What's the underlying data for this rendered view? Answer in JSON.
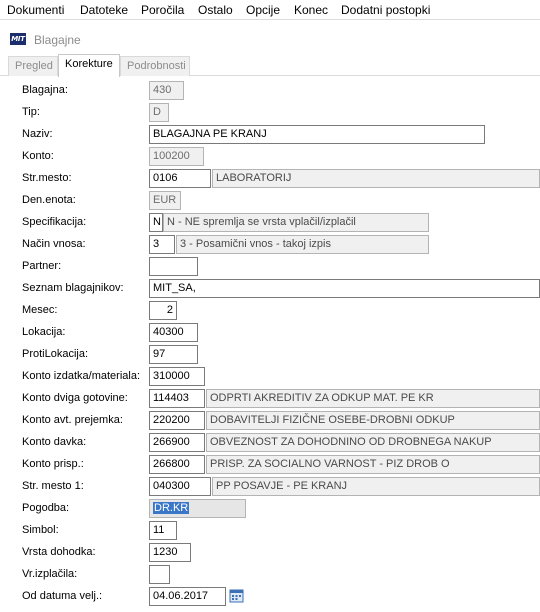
{
  "menu": [
    "Dokumenti",
    "Datoteke",
    "Poročila",
    "Ostalo",
    "Opcije",
    "Konec",
    "Dodatni postopki"
  ],
  "window": {
    "logo": "MIT",
    "title": "Blagajne"
  },
  "tabs": [
    "Pregled",
    "Korekture",
    "Podrobnosti"
  ],
  "form": {
    "blagajna": {
      "label": "Blagajna:",
      "value": "430"
    },
    "tip": {
      "label": "Tip:",
      "value": "D"
    },
    "naziv": {
      "label": "Naziv:",
      "value": "BLAGAJNA PE KRANJ"
    },
    "konto": {
      "label": "Konto:",
      "value": "100200"
    },
    "strmesto": {
      "label": "Str.mesto:",
      "value": "0106",
      "desc": "LABORATORIJ"
    },
    "denenota": {
      "label": "Den.enota:",
      "value": "EUR"
    },
    "specifikacija": {
      "label": "Specifikacija:",
      "value": "N",
      "desc": "N - NE spremlja se vrsta vplačil/izplačil"
    },
    "nacin": {
      "label": "Način vnosa:",
      "value": "3",
      "desc": "3 - Posamični vnos - takoj izpis"
    },
    "partner": {
      "label": "Partner:",
      "value": ""
    },
    "seznam": {
      "label": "Seznam blagajnikov:",
      "value": "MIT_SA,"
    },
    "mesec": {
      "label": "Mesec:",
      "value": "2"
    },
    "lokacija": {
      "label": "Lokacija:",
      "value": "40300"
    },
    "protilokacija": {
      "label": "ProtiLokacija:",
      "value": "97"
    },
    "konto_izdatka": {
      "label": "Konto izdatka/materiala:",
      "value": "310000"
    },
    "konto_dviga": {
      "label": "Konto dviga gotovine:",
      "value": "114403",
      "desc": "ODPRTI AKREDITIV ZA ODKUP MAT. PE KR"
    },
    "konto_avt": {
      "label": "Konto avt. prejemka:",
      "value": "220200",
      "desc": "DOBAVITELJI FIZIČNE OSEBE-DROBNI ODKUP"
    },
    "konto_davka": {
      "label": "Konto davka:",
      "value": "266900",
      "desc": "OBVEZNOST ZA DOHODNINO OD DROBNEGA NAKUP"
    },
    "konto_prisp": {
      "label": "Konto prisp.:",
      "value": "266800",
      "desc": "PRISP. ZA SOCIALNO VARNOST - PIZ DROB O"
    },
    "strmesto1": {
      "label": "Str. mesto 1:",
      "value": "040300",
      "desc": "PP POSAVJE - PE KRANJ"
    },
    "pogodba": {
      "label": "Pogodba:",
      "value": "DR.KR"
    },
    "simbol": {
      "label": "Simbol:",
      "value": "11"
    },
    "vrsta": {
      "label": "Vrsta dohodka:",
      "value": "1230"
    },
    "vrizplacila": {
      "label": "Vr.izplačila:",
      "value": ""
    },
    "od_datuma": {
      "label": "Od datuma velj.:",
      "value": "04.06.2017"
    }
  },
  "icons": {
    "calendar": "calendar-icon"
  }
}
